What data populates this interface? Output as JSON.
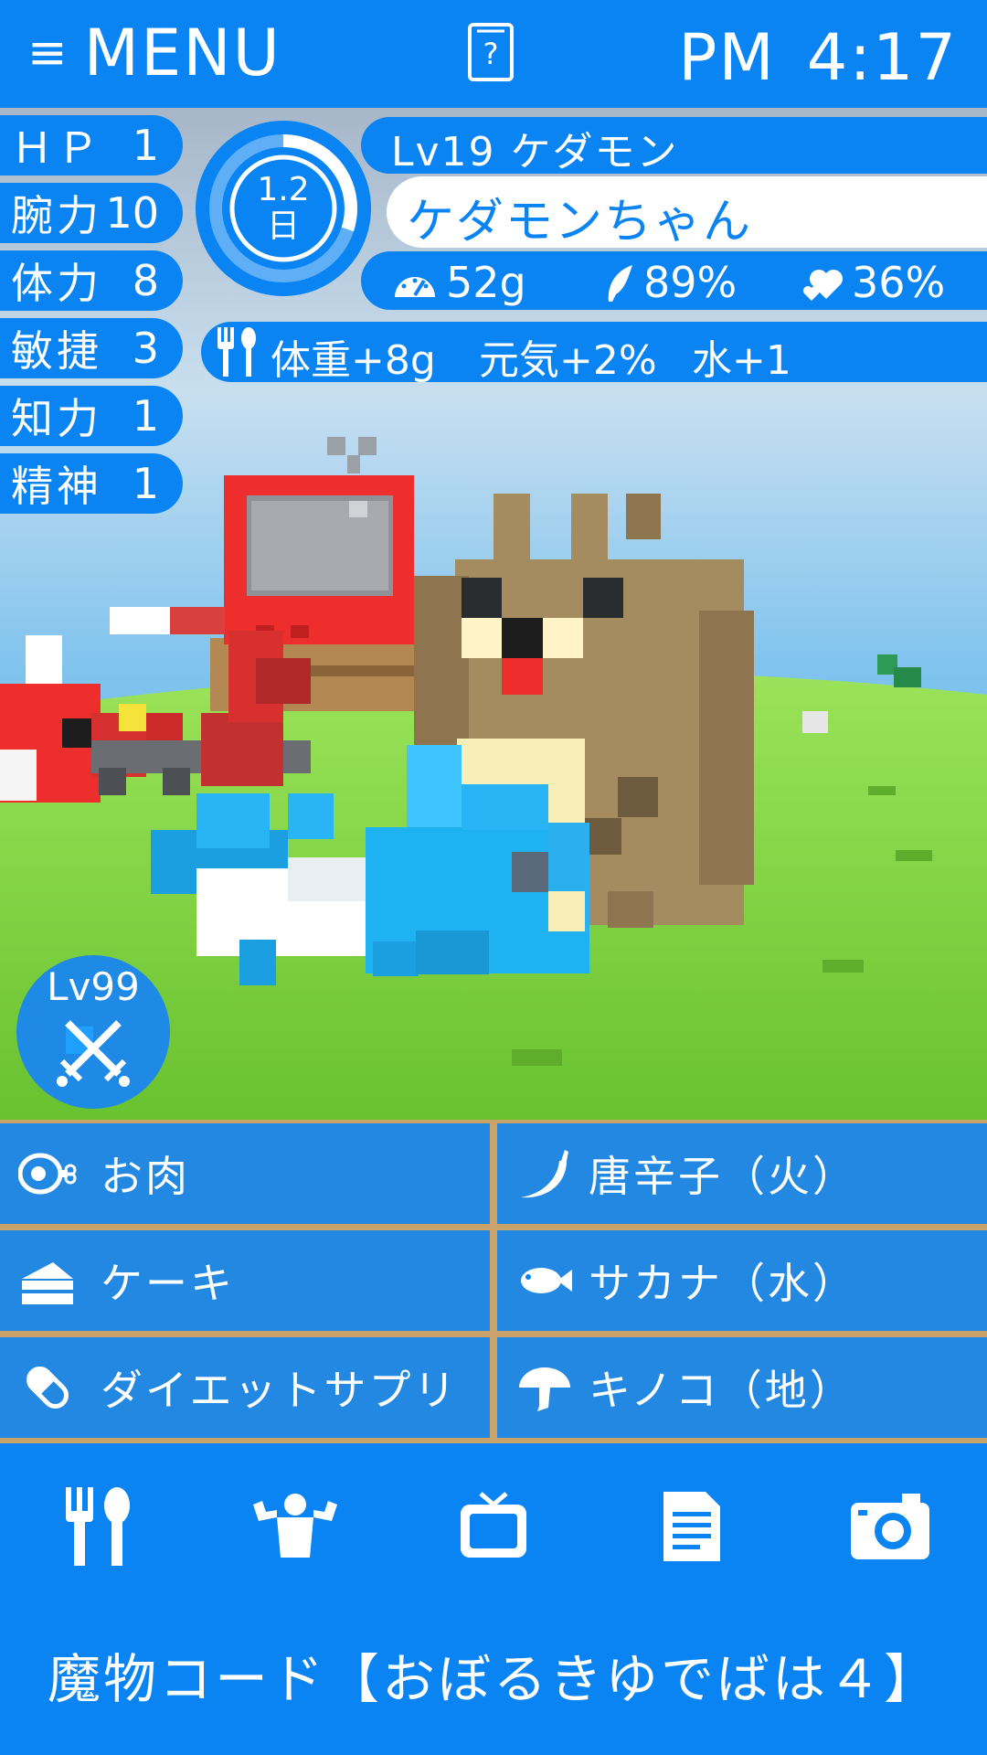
{
  "header": {
    "menu_icon": "hamburger-icon",
    "menu_label": "MENU",
    "help_icon": "help-card-icon",
    "help_glyph": "?",
    "clock_ampm": "PM",
    "clock_time": "4:17"
  },
  "stats": [
    {
      "name": "ＨＰ",
      "value": "1"
    },
    {
      "name": "腕力",
      "value": "10"
    },
    {
      "name": "体力",
      "value": "8"
    },
    {
      "name": "敏捷",
      "value": "3"
    },
    {
      "name": "知力",
      "value": "1"
    },
    {
      "name": "精神",
      "value": "1"
    }
  ],
  "pet": {
    "day_number": "1.2",
    "day_unit": "日",
    "day_progress": 0.3,
    "level_name": "Lv19  ケダモン",
    "name": "ケダモンちゃん",
    "weight": "52g",
    "energy": "89%",
    "affection": "36%"
  },
  "effects": {
    "icon": "fork-spoon-icon",
    "weight": "体重+8g",
    "energy": "元気+2%",
    "water": "水+1"
  },
  "battle": {
    "level": "Lv99",
    "icon": "crossed-swords-icon"
  },
  "foods": [
    {
      "label": "お肉",
      "icon": "meat-icon"
    },
    {
      "label": "唐辛子（火）",
      "icon": "chili-icon"
    },
    {
      "label": "ケーキ",
      "icon": "cake-icon"
    },
    {
      "label": "サカナ（水）",
      "icon": "fish-icon"
    },
    {
      "label": "ダイエットサプリ",
      "icon": "pill-icon"
    },
    {
      "label": "キノコ（地）",
      "icon": "mushroom-icon"
    }
  ],
  "nav": [
    "fork-spoon-icon",
    "muscle-icon",
    "tv-icon",
    "document-icon",
    "camera-icon"
  ],
  "monster_code": "魔物コード【おぼるきゆでばは４】",
  "colors": {
    "primary": "#0a84f2",
    "sky": "#8ec9f0",
    "grass": "#7ed640",
    "divider": "#c9a36a"
  }
}
